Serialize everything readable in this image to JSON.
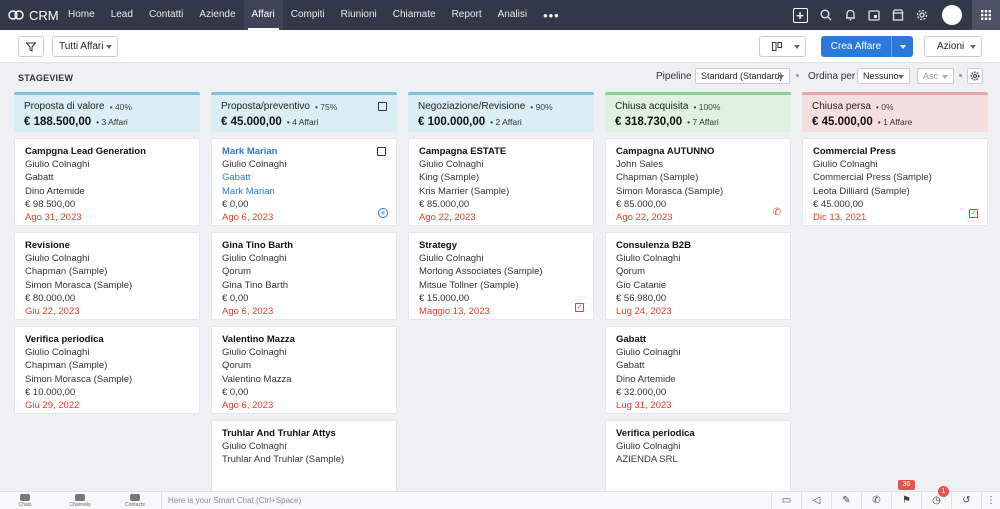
{
  "app": {
    "name": "CRM"
  },
  "nav": {
    "items": [
      "Home",
      "Lead",
      "Contatti",
      "Aziende",
      "Affari",
      "Compiti",
      "Riunioni",
      "Chiamate",
      "Report",
      "Analisi"
    ],
    "active": "Affari",
    "more": "•••"
  },
  "toolbar": {
    "view_select": "Tutti Affari",
    "create_button": "Crea Affare",
    "actions_button": "Azioni"
  },
  "stageview": {
    "label": "STAGEVIEW",
    "pipeline_label": "Pipeline",
    "pipeline_value": "Standard (Standard)",
    "sort_label": "Ordina per",
    "sort_value": "Nessuno",
    "order_value": "Asc"
  },
  "columns": [
    {
      "name": "Proposta di valore",
      "percent": "• 40%",
      "amount": "€ 188.500,00",
      "count": "• 3 Affari",
      "color": "#7fc1d6",
      "bg": "#d9eef5",
      "cards": [
        {
          "title": "Campgna Lead Generation",
          "lines": [
            "Giulio Colnaghi",
            "Gabatt",
            "Dino Artemide",
            "€ 98.500,00"
          ],
          "date": "Ago 31, 2023"
        },
        {
          "title": "Revisione",
          "lines": [
            "Giulio Colnaghi",
            "Chapman (Sample)",
            "Simon Morasca (Sample)",
            "€ 80.000,00"
          ],
          "date": "Giu 22, 2023"
        },
        {
          "title": "Verifica periodica",
          "lines": [
            "Giulio Colnaghi",
            "Chapman (Sample)",
            "Simon Morasca (Sample)",
            "€ 10.000,00"
          ],
          "date": "Giu 29, 2022"
        }
      ]
    },
    {
      "name": "Proposta/preventivo",
      "percent": "• 75%",
      "amount": "€ 45.000,00",
      "count": "• 4 Affari",
      "color": "#7fc1d6",
      "bg": "#d9eef5",
      "cards": [
        {
          "title": "Mark Marian",
          "lines": [
            "Giulio Colnaghi",
            "Gabatt",
            "Mark Marian",
            "€ 0,00"
          ],
          "date": "Ago 6, 2023"
        },
        {
          "title": "Gina Tino Barth",
          "lines": [
            "Giulio Colnaghi",
            "Qorum",
            "Gina Tino Barth",
            "€ 0,00"
          ],
          "date": "Ago 6, 2023"
        },
        {
          "title": "Valentino Mazza",
          "lines": [
            "Giulio Colnaghi",
            "Qorum",
            "Valentino Mazza",
            "€ 0,00"
          ],
          "date": "Ago 6, 2023"
        },
        {
          "title": "Truhlar And Truhlar Attys",
          "lines": [
            "Giulio Colnaghi",
            "Truhlar And Truhlar (Sample)"
          ],
          "date": ""
        }
      ]
    },
    {
      "name": "Negoziazione/Revisione",
      "percent": "• 90%",
      "amount": "€ 100.000,00",
      "count": "• 2 Affari",
      "color": "#7fc1d6",
      "bg": "#d9eef5",
      "cards": [
        {
          "title": "Campagna ESTATE",
          "lines": [
            "Giulio Colnaghi",
            "King (Sample)",
            "Kris Marrier (Sample)",
            "€ 85.000,00"
          ],
          "date": "Ago 22, 2023"
        },
        {
          "title": "Strategy",
          "lines": [
            "Giulio Colnaghi",
            "Morlong Associates (Sample)",
            "Mitsue Tollner (Sample)",
            "€ 15.000,00"
          ],
          "date": "Maggio 13, 2023"
        }
      ]
    },
    {
      "name": "Chiusa acquisita",
      "percent": "• 100%",
      "amount": "€ 318.730,00",
      "count": "• 7 Affari",
      "color": "#8dcf95",
      "bg": "#dff2e0",
      "cards": [
        {
          "title": "Campagna AUTUNNO",
          "lines": [
            "John Sales",
            "Chapman (Sample)",
            "Simon Morasca (Sample)",
            "€ 85.000,00"
          ],
          "date": "Ago 22, 2023"
        },
        {
          "title": "Consulenza B2B",
          "lines": [
            "Giulio Colnaghi",
            "Qorum",
            "Gio Catanie",
            "€ 56.980,00"
          ],
          "date": "Lug 24, 2023"
        },
        {
          "title": "Gabatt",
          "lines": [
            "Giulio Colnaghi",
            "Gabatt",
            "Dino Artemide",
            "€ 32.000,00"
          ],
          "date": "Lug 31, 2023"
        },
        {
          "title": "Verifica periodica",
          "lines": [
            "Giulio Colnaghi",
            "AZIENDA SRL"
          ],
          "date": ""
        }
      ]
    },
    {
      "name": "Chiusa persa",
      "percent": "• 0%",
      "amount": "€ 45.000,00",
      "count": "• 1 Affare",
      "color": "#e8a3a3",
      "bg": "#f7dede",
      "cards": [
        {
          "title": "Commercial Press",
          "lines": [
            "Giulio Colnaghi",
            "Commercial Press (Sample)",
            "Leota Dilliard (Sample)",
            "€ 45.000,00"
          ],
          "date": "Dic 13, 2021"
        }
      ]
    }
  ],
  "footer": {
    "chats": "Chats",
    "channels": "Channels",
    "contacts": "Contacts",
    "chat_placeholder": "Here is your Smart Chat (Ctrl+Space)",
    "badge_count": "36",
    "alarm_count": "1"
  }
}
